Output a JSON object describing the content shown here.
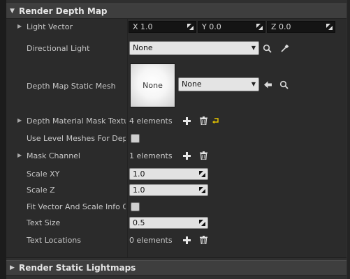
{
  "header_depth": {
    "title": "Render Depth Map"
  },
  "header_lightmaps": {
    "title": "Render Static Lightmaps"
  },
  "light_vector": {
    "label": "Light Vector",
    "x": "X  1.0",
    "y": "Y  0.0",
    "z": "Z  0.0"
  },
  "directional_light": {
    "label": "Directional Light",
    "value": "None"
  },
  "static_mesh": {
    "label": "Depth Map Static Mesh",
    "thumb_text": "None",
    "value": "None"
  },
  "mask_textures": {
    "label": "Depth Material Mask Textur",
    "count": "4 elements"
  },
  "use_level_meshes": {
    "label": "Use Level Meshes For Depth"
  },
  "mask_channel": {
    "label": "Mask Channel",
    "count": "1 elements"
  },
  "scale_xy": {
    "label": "Scale XY",
    "value": "1.0"
  },
  "scale_z": {
    "label": "Scale Z",
    "value": "1.0"
  },
  "fit_vector": {
    "label": "Fit Vector And Scale Info On"
  },
  "text_size": {
    "label": "Text Size",
    "value": "0.5"
  },
  "text_locations": {
    "label": "Text Locations",
    "count": "0 elements"
  }
}
